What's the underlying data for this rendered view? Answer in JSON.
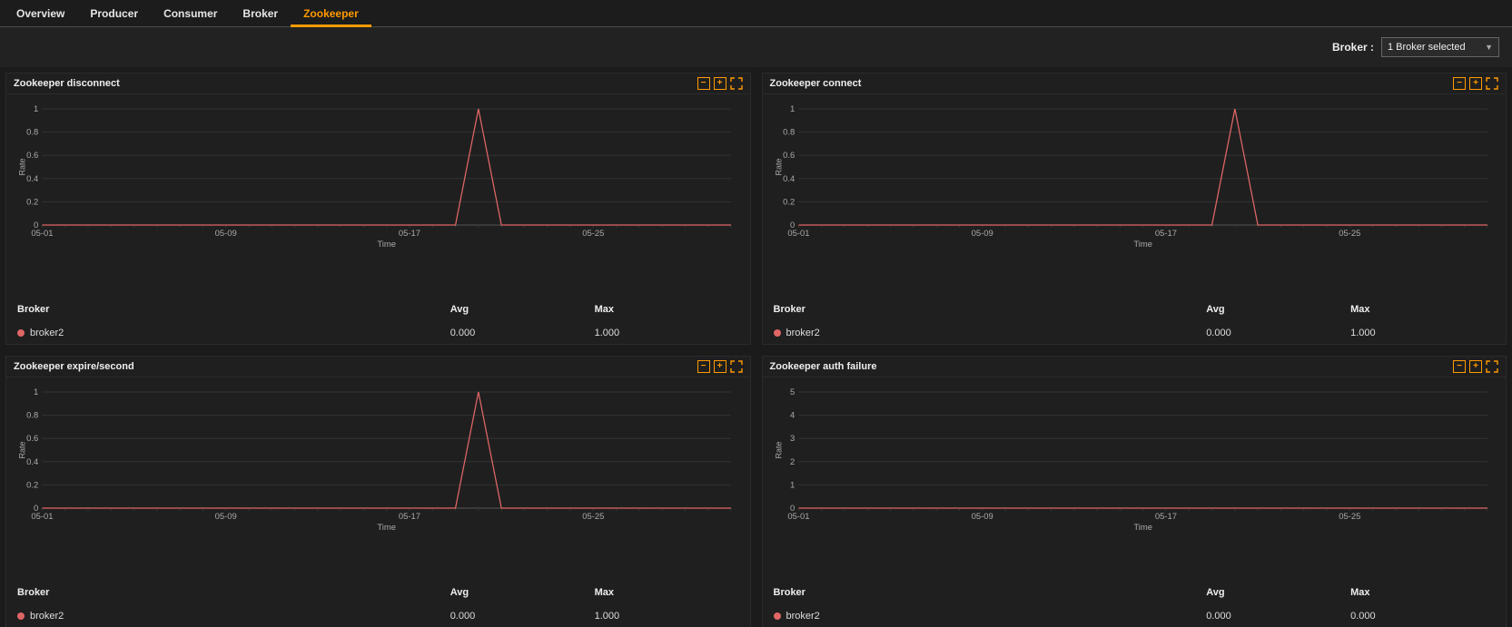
{
  "tabs": [
    "Overview",
    "Producer",
    "Consumer",
    "Broker",
    "Zookeeper"
  ],
  "active_tab_index": 4,
  "toolbar": {
    "broker_label": "Broker :",
    "broker_selected": "1 Broker selected"
  },
  "headers": {
    "broker": "Broker",
    "avg": "Avg",
    "max": "Max"
  },
  "axis": {
    "ylabel": "Rate",
    "xlabel": "Time"
  },
  "panels": [
    {
      "title": "Zookeeper disconnect",
      "broker": "broker2",
      "avg": "0.000",
      "max": "1.000",
      "chart": "spike"
    },
    {
      "title": "Zookeeper connect",
      "broker": "broker2",
      "avg": "0.000",
      "max": "1.000",
      "chart": "spike"
    },
    {
      "title": "Zookeeper expire/second",
      "broker": "broker2",
      "avg": "0.000",
      "max": "1.000",
      "chart": "spike"
    },
    {
      "title": "Zookeeper auth failure",
      "broker": "broker2",
      "avg": "0.000",
      "max": "0.000",
      "chart": "flat5"
    }
  ],
  "chart_data": [
    {
      "type": "line",
      "title": "Zookeeper disconnect",
      "xlabel": "Time",
      "ylabel": "Rate",
      "ylim": [
        0.0,
        1.0
      ],
      "yticks": [
        0.0,
        0.2,
        0.4,
        0.6,
        0.8,
        1.0
      ],
      "xticks": [
        "05-01",
        "05-09",
        "05-17",
        "05-25"
      ],
      "series": [
        {
          "name": "broker2",
          "color": "#e06666",
          "x": [
            "05-01",
            "05-09",
            "05-17",
            "05-19",
            "05-20",
            "05-21",
            "05-25",
            "05-31"
          ],
          "y": [
            0.0,
            0.0,
            0.0,
            0.0,
            1.0,
            0.0,
            0.0,
            0.0
          ]
        }
      ]
    },
    {
      "type": "line",
      "title": "Zookeeper connect",
      "xlabel": "Time",
      "ylabel": "Rate",
      "ylim": [
        0.0,
        1.0
      ],
      "yticks": [
        0.0,
        0.2,
        0.4,
        0.6,
        0.8,
        1.0
      ],
      "xticks": [
        "05-01",
        "05-09",
        "05-17",
        "05-25"
      ],
      "series": [
        {
          "name": "broker2",
          "color": "#e06666",
          "x": [
            "05-01",
            "05-09",
            "05-17",
            "05-19",
            "05-20",
            "05-21",
            "05-25",
            "05-31"
          ],
          "y": [
            0.0,
            0.0,
            0.0,
            0.0,
            1.0,
            0.0,
            0.0,
            0.0
          ]
        }
      ]
    },
    {
      "type": "line",
      "title": "Zookeeper expire/second",
      "xlabel": "Time",
      "ylabel": "Rate",
      "ylim": [
        0.0,
        1.0
      ],
      "yticks": [
        0.0,
        0.2,
        0.4,
        0.6,
        0.8,
        1.0
      ],
      "xticks": [
        "05-01",
        "05-09",
        "05-17",
        "05-25"
      ],
      "series": [
        {
          "name": "broker2",
          "color": "#e06666",
          "x": [
            "05-01",
            "05-09",
            "05-17",
            "05-19",
            "05-20",
            "05-21",
            "05-25",
            "05-31"
          ],
          "y": [
            0.0,
            0.0,
            0.0,
            0.0,
            1.0,
            0.0,
            0.0,
            0.0
          ]
        }
      ]
    },
    {
      "type": "line",
      "title": "Zookeeper auth failure",
      "xlabel": "Time",
      "ylabel": "Rate",
      "ylim": [
        0,
        5
      ],
      "yticks": [
        0,
        1,
        2,
        3,
        4,
        5
      ],
      "xticks": [
        "05-01",
        "05-09",
        "05-17",
        "05-25"
      ],
      "series": [
        {
          "name": "broker2",
          "color": "#e06666",
          "x": [
            "05-01",
            "05-09",
            "05-17",
            "05-25",
            "05-31"
          ],
          "y": [
            0,
            0,
            0,
            0,
            0
          ]
        }
      ]
    }
  ]
}
